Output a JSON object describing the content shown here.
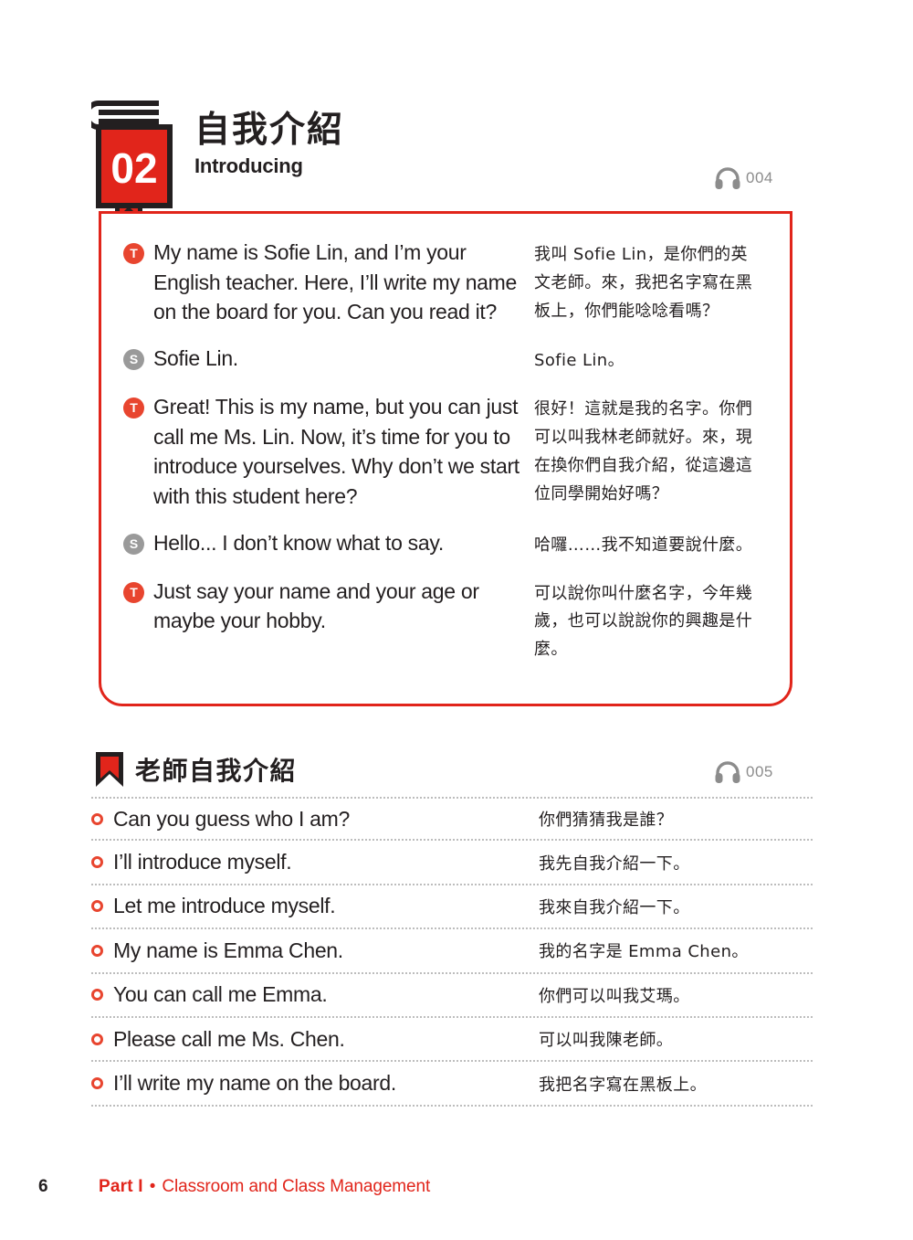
{
  "colors": {
    "brand_red": "#e1251b",
    "accent_orange": "#e8452f",
    "gray_badge": "#9a9a9a",
    "text": "#231f20",
    "muted_gray": "#8c8c8c"
  },
  "header": {
    "chapter_number": "02",
    "title_zh": "自我介紹",
    "title_en": "Introducing",
    "audio_track": "004"
  },
  "dialogue": [
    {
      "speaker": "T",
      "speaker_role": "teacher",
      "en": "My name is Sofie Lin, and I’m your English teacher. Here, I’ll write my name on the board for you. Can you read it?",
      "zh": "我叫 Sofie Lin，是你們的英文老師。來，我把名字寫在黑板上，你們能唸唸看嗎？"
    },
    {
      "speaker": "S",
      "speaker_role": "student",
      "en": "Sofie Lin.",
      "zh": "Sofie Lin。"
    },
    {
      "speaker": "T",
      "speaker_role": "teacher",
      "en": "Great! This is my name, but you can just call me Ms. Lin. Now, it’s time for you to introduce yourselves. Why don’t we start with this student here?",
      "zh": "很好！這就是我的名字。你們可以叫我林老師就好。來，現在換你們自我介紹，從這邊這位同學開始好嗎？"
    },
    {
      "speaker": "S",
      "speaker_role": "student",
      "en": "Hello... I don’t know what to say.",
      "zh": "哈囉……我不知道要說什麼。"
    },
    {
      "speaker": "T",
      "speaker_role": "teacher",
      "en": "Just say your name and your age or maybe your hobby.",
      "zh": "可以說你叫什麼名字，今年幾歲，也可以說說你的興趣是什麼。"
    }
  ],
  "section": {
    "title_zh": "老師自我介紹",
    "audio_track": "005"
  },
  "phrases": [
    {
      "en": "Can you guess who I am?",
      "zh": "你們猜猜我是誰？"
    },
    {
      "en": "I’ll introduce myself.",
      "zh": "我先自我介紹一下。"
    },
    {
      "en": "Let me introduce myself.",
      "zh": "我來自我介紹一下。"
    },
    {
      "en": "My name is Emma Chen.",
      "zh": "我的名字是 Emma Chen。"
    },
    {
      "en": "You can call me Emma.",
      "zh": "你們可以叫我艾瑪。"
    },
    {
      "en": "Please call me Ms. Chen.",
      "zh": "可以叫我陳老師。"
    },
    {
      "en": "I’ll write my name on the board.",
      "zh": "我把名字寫在黑板上。"
    }
  ],
  "footer": {
    "page_number": "6",
    "part_label": "Part I",
    "separator": "•",
    "part_title": "Classroom and Class Management"
  }
}
